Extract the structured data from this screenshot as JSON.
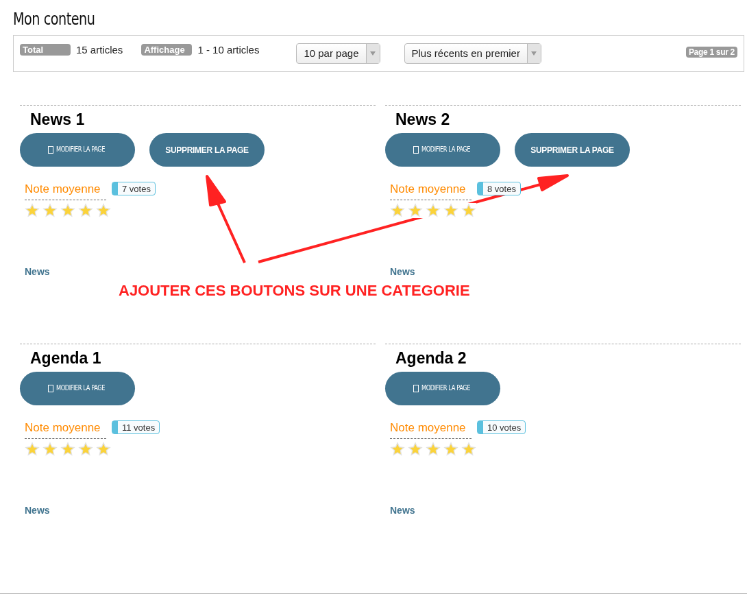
{
  "title": "Mon contenu",
  "toolbar": {
    "total_label": "Total",
    "total_value": "15 articles",
    "display_label": "Affichage",
    "display_value": "1 - 10 articles",
    "per_page": "10 par page",
    "sort": "Plus récents en premier",
    "page_badge": "Page 1 sur 2"
  },
  "cards": [
    {
      "title": "News 1",
      "buttons": [
        {
          "kind": "edit",
          "label": "MODIFIER LA PAGE"
        },
        {
          "kind": "delete",
          "label": "SUPPRIMER LA PAGE"
        }
      ],
      "rating_label": "Note moyenne",
      "votes": "7 votes",
      "stars": 5,
      "category": "News"
    },
    {
      "title": "News 2",
      "buttons": [
        {
          "kind": "edit",
          "label": "MODIFIER LA PAGE"
        },
        {
          "kind": "delete",
          "label": "SUPPRIMER LA PAGE"
        }
      ],
      "rating_label": "Note moyenne",
      "votes": "8 votes",
      "stars": 5,
      "category": "News"
    },
    {
      "title": "Agenda 1",
      "buttons": [
        {
          "kind": "edit",
          "label": "MODIFIER LA PAGE"
        }
      ],
      "rating_label": "Note moyenne",
      "votes": "11 votes",
      "stars": 5,
      "category": "News"
    },
    {
      "title": "Agenda 2",
      "buttons": [
        {
          "kind": "edit",
          "label": "MODIFIER LA PAGE"
        }
      ],
      "rating_label": "Note moyenne",
      "votes": "10 votes",
      "stars": 5,
      "category": "News"
    }
  ],
  "annotation": {
    "text": "AJOUTER CES BOUTONS SUR UNE CATEGORIE"
  }
}
